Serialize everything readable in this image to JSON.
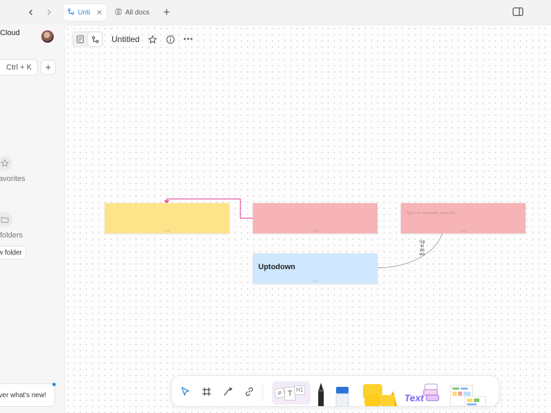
{
  "tabs": [
    {
      "label": "Untitled",
      "active": true
    },
    {
      "label": "All docs",
      "active": false
    }
  ],
  "sidebar": {
    "workspace_name": "Cloud",
    "search_shortcut": "Ctrl + K",
    "favorites_label": "avorites",
    "folders_label": "folders",
    "new_folder_label": "w folder",
    "whats_new_label": "ver what's new!"
  },
  "editor": {
    "doc_title": "Untitled"
  },
  "canvas": {
    "notes": [
      {
        "color": "#fde48a",
        "text": ""
      },
      {
        "color": "#f6b4b6",
        "text": ""
      },
      {
        "color": "#f6b4b6",
        "text": "Type / for commands, press Tab"
      },
      {
        "color": "#cfe8fd",
        "text": "Uptodown"
      }
    ],
    "connector_label": "Uptodown",
    "connector_colors": {
      "pink": "#e0559a",
      "gray": "#9a9a9a"
    }
  },
  "toolbar": {
    "tools": [
      "select-icon",
      "frame-icon",
      "connector-icon",
      "link-icon",
      "text-icon",
      "pen-icon",
      "eraser-icon",
      "shape-icon",
      "template-icon"
    ],
    "text_tool_label": "Text",
    "heading_label": "H1"
  },
  "colors": {
    "accent": "#2b8be0",
    "sidebar_bg": "#f6f6f6",
    "canvas_bg": "#fdfdfd"
  }
}
